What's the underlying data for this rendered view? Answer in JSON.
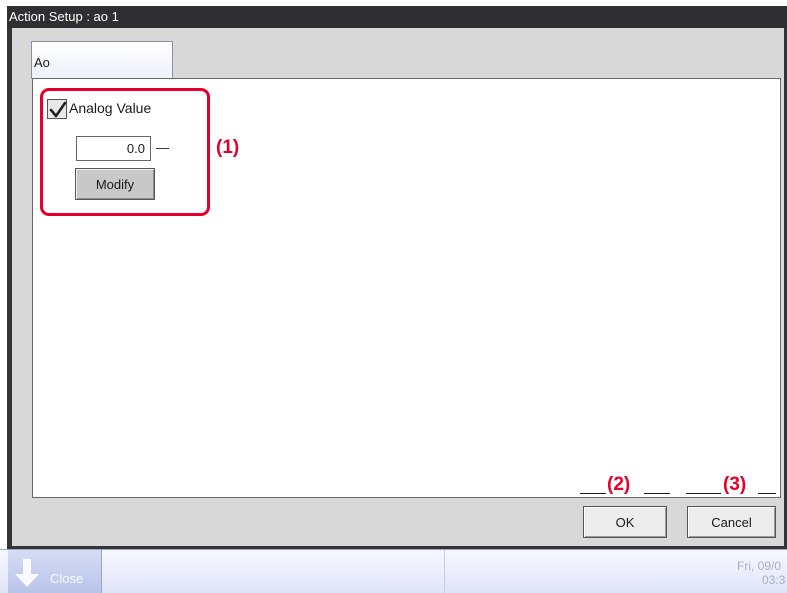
{
  "window": {
    "title": "Action Setup : ao 1"
  },
  "tab": {
    "label": "Ao"
  },
  "analog": {
    "checkbox_label": "Analog Value",
    "checked": true,
    "value": "0.0",
    "unit": "—",
    "modify_label": "Modify"
  },
  "callouts": {
    "c1": "(1)",
    "c2": "(2)",
    "c3": "(3)"
  },
  "buttons": {
    "ok": "OK",
    "cancel": "Cancel"
  },
  "taskbar": {
    "close_label": "Close",
    "date": "Fri, 09/0",
    "time": "03:3"
  },
  "colors": {
    "accent": "#e4002b",
    "title_bar": "#2f2f33",
    "taskbar": "#dfe3f8"
  },
  "icons": {
    "checkbox": "checkmark-icon",
    "close": "down-arrow-icon"
  }
}
